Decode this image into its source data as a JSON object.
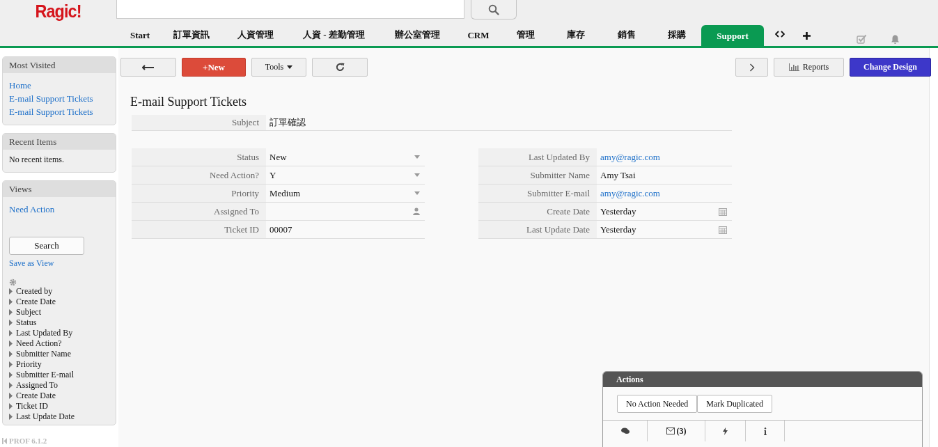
{
  "header": {
    "logo": "Ragic!"
  },
  "tabs": [
    {
      "label": "Start",
      "selected": false
    },
    {
      "label": "訂單資訊",
      "selected": false
    },
    {
      "label": "人資管理",
      "selected": false
    },
    {
      "label": "人資 - 差勤管理",
      "selected": false
    },
    {
      "label": "辦公室管理",
      "selected": false
    },
    {
      "label": "CRM",
      "selected": false
    },
    {
      "label": "管理",
      "selected": false
    },
    {
      "label": "庫存",
      "selected": false
    },
    {
      "label": "銷售",
      "selected": false
    },
    {
      "label": "採購",
      "selected": false
    },
    {
      "label": "Support",
      "selected": true
    }
  ],
  "sidebar": {
    "panels": [
      {
        "title": "Most Visited",
        "links": [
          "Home",
          "E-mail Support Tickets",
          "E-mail Support Tickets"
        ]
      },
      {
        "title": "Recent Items",
        "note": "No recent items."
      }
    ],
    "views": {
      "title": "Views",
      "links": [
        "Need Action"
      ],
      "search_button": "Search",
      "save_link": "Save as View",
      "fields": [
        "Created by",
        "Create Date",
        "Subject",
        "Status",
        "Last Updated By",
        "Need Action?",
        "Submitter Name",
        "Priority",
        "Submitter E-mail",
        "Assigned To",
        "Create Date",
        "Ticket ID",
        "Last Update Date"
      ]
    },
    "version": "PROF 6.1.2"
  },
  "toolbar": {
    "new_button": "+New",
    "tools_button": "Tools",
    "reports_button": "Reports",
    "design_button": "Change Design"
  },
  "form": {
    "title": "E-mail Support Tickets",
    "subject": {
      "label": "Subject",
      "value": "訂單確認"
    },
    "left": [
      {
        "label": "Status",
        "value": "New",
        "kind": "dropdown"
      },
      {
        "label": "Need Action?",
        "value": "Y",
        "kind": "dropdown"
      },
      {
        "label": "Priority",
        "value": "Medium",
        "kind": "dropdown"
      },
      {
        "label": "Assigned To",
        "kind": "user"
      },
      {
        "label": "Ticket ID",
        "value": "00007",
        "kind": "text"
      }
    ],
    "right": [
      {
        "label": "Last Updated By",
        "value": "amy@ragic.com",
        "kind": "link"
      },
      {
        "label": "Submitter Name",
        "value": "Amy Tsai",
        "kind": "text"
      },
      {
        "label": "Submitter E-mail",
        "value": "amy@ragic.com",
        "kind": "link"
      },
      {
        "label": "Create Date",
        "value": "Yesterday",
        "kind": "date"
      },
      {
        "label": "Last Update Date",
        "value": "Yesterday",
        "kind": "date"
      }
    ]
  },
  "actions": {
    "title": "Actions",
    "buttons": [
      "No Action Needed",
      "Mark Duplicated"
    ],
    "email_count": "(3)"
  }
}
